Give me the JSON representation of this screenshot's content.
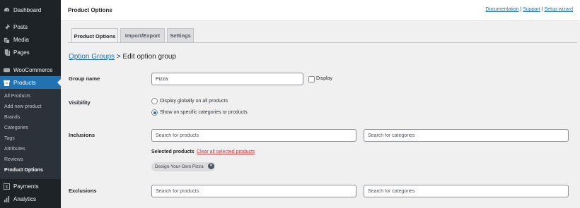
{
  "sidebar": {
    "items": [
      {
        "label": "Dashboard",
        "icon": "dashboard-icon"
      },
      {
        "label": "Posts",
        "icon": "pin-icon"
      },
      {
        "label": "Media",
        "icon": "media-icon"
      },
      {
        "label": "Pages",
        "icon": "pages-icon"
      },
      {
        "label": "WooCommerce",
        "icon": "woocommerce-icon"
      },
      {
        "label": "Products",
        "icon": "archive-icon"
      },
      {
        "label": "Payments",
        "icon": "payments-icon"
      },
      {
        "label": "Analytics",
        "icon": "chart-bar-icon"
      }
    ],
    "submenu": [
      "All Products",
      "Add new product",
      "Brands",
      "Categories",
      "Tags",
      "Attributes",
      "Reviews",
      "Product Options"
    ]
  },
  "header": {
    "title": "Product Options",
    "links": {
      "documentation": "Documentation",
      "support": "Support",
      "setup": "Setup wizard",
      "sep": "|"
    }
  },
  "tabs": [
    "Product Options",
    "Import/Export",
    "Settings"
  ],
  "breadcrumb": {
    "link": "Option Groups",
    "current": "> Edit option group"
  },
  "form": {
    "group_name": {
      "label": "Group name",
      "value": "Pizza",
      "display_label": "Display"
    },
    "visibility": {
      "label": "Visibility",
      "options": [
        "Display globally on all products",
        "Show on specific categories or products"
      ],
      "selected": 1
    },
    "inclusions": {
      "label": "Inclusions",
      "products_placeholder": "Search for products",
      "categories_placeholder": "Search for categories",
      "selected_label": "Selected products",
      "clear_label": "Clear all selected products",
      "selected_items": [
        "Design-Your-Own Pizza"
      ]
    },
    "exclusions": {
      "label": "Exclusions",
      "products_placeholder": "Search for products",
      "categories_placeholder": "Search for categories"
    }
  },
  "colors": {
    "accent": "#2271b1",
    "sidebar": "#1d2327",
    "danger": "#d63638"
  }
}
